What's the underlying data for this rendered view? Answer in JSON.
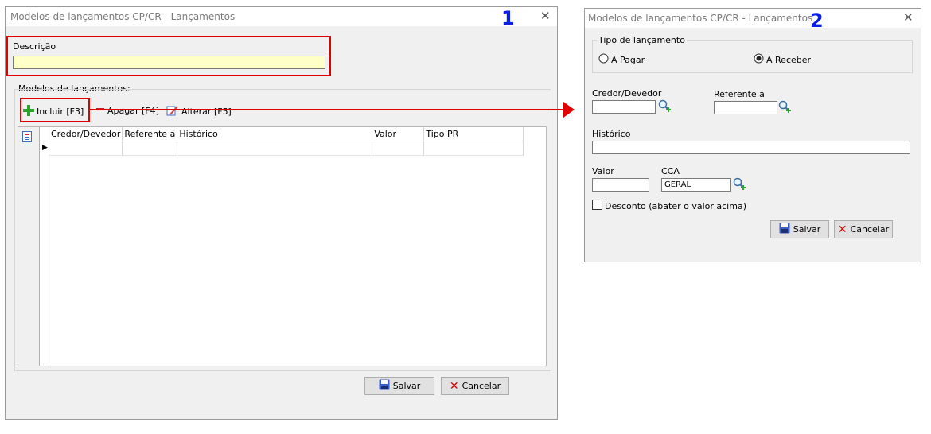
{
  "win1": {
    "number": "1",
    "title": "Modelos de lançamentos CP/CR - Lançamentos",
    "close_glyph": "✕",
    "descricao_label": "Descrição",
    "descricao_value": "",
    "group_label": "Modelos de lançamentos:",
    "toolbar": {
      "incluir": "Incluir [F3]",
      "apagar": "Apagar [F4]",
      "alterar": "Alterar [F5]"
    },
    "grid_columns": [
      "Credor/Devedor",
      "Referente a",
      "Histórico",
      "Valor",
      "Tipo PR"
    ],
    "salvar": "Salvar",
    "cancelar": "Cancelar"
  },
  "win2": {
    "number": "2",
    "title": "Modelos de lançamentos CP/CR  - Lançamentos",
    "close_glyph": "✕",
    "tipo_label": "Tipo de lançamento",
    "radio_pagar": "A Pagar",
    "radio_receber": "A Receber",
    "radio_selected": "A Receber",
    "credor_label": "Credor/Devedor",
    "credor_value": "",
    "referente_label": "Referente a",
    "referente_value": "",
    "historico_label": "Histórico",
    "historico_value": "",
    "valor_label": "Valor",
    "valor_value": "",
    "cca_label": "CCA",
    "cca_value": "GERAL",
    "desconto_label": "Desconto (abater o valor acima)",
    "desconto_checked": false,
    "salvar": "Salvar",
    "cancelar": "Cancelar"
  },
  "colors": {
    "highlight_red": "#e00000",
    "number_blue": "#0a1ee6",
    "description_field_bg": "#ffffc8"
  }
}
